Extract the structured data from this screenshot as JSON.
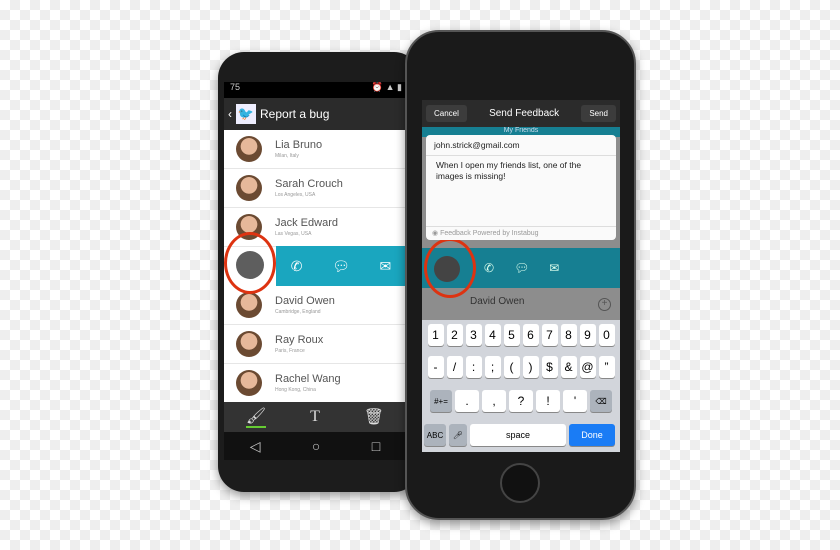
{
  "android": {
    "status_left": "75",
    "title": "Report a bug",
    "contacts": [
      {
        "name": "Lia Bruno",
        "location": "Milan, Italy"
      },
      {
        "name": "Sarah Crouch",
        "location": "Los Angeles, USA"
      },
      {
        "name": "Jack Edward",
        "location": "Las Vegas, USA"
      },
      {
        "name": "David Owen",
        "location": "Cambridge, England"
      },
      {
        "name": "Ray Roux",
        "location": "Paris, France"
      },
      {
        "name": "Rachel Wang",
        "location": "Hong Kong, China"
      }
    ],
    "accent": "#1aa6bf",
    "toolbar": [
      "brush-icon",
      "text-icon",
      "trash-icon"
    ]
  },
  "ios": {
    "cancel": "Cancel",
    "title": "Send Feedback",
    "send": "Send",
    "underlay_title": "My Friends",
    "email": "john.strick@gmail.com",
    "message": "When I open my friends list, one of the images is missing!",
    "footer": "Feedback Powered by Instabug",
    "underlay_contact": "David Owen",
    "underlay_location": "Cambridge, England",
    "keys_row1": [
      "1",
      "2",
      "3",
      "4",
      "5",
      "6",
      "7",
      "8",
      "9",
      "0"
    ],
    "keys_row2": [
      "-",
      "/",
      ":",
      ";",
      "(",
      ")",
      "$",
      "&",
      "@",
      "”"
    ],
    "keys_row3": [
      "#+=",
      ".",
      ",",
      "?",
      "!",
      "'",
      "⌫"
    ],
    "abc": "ABC",
    "space": "space",
    "done": "Done",
    "done_color": "#1a7cf5"
  }
}
